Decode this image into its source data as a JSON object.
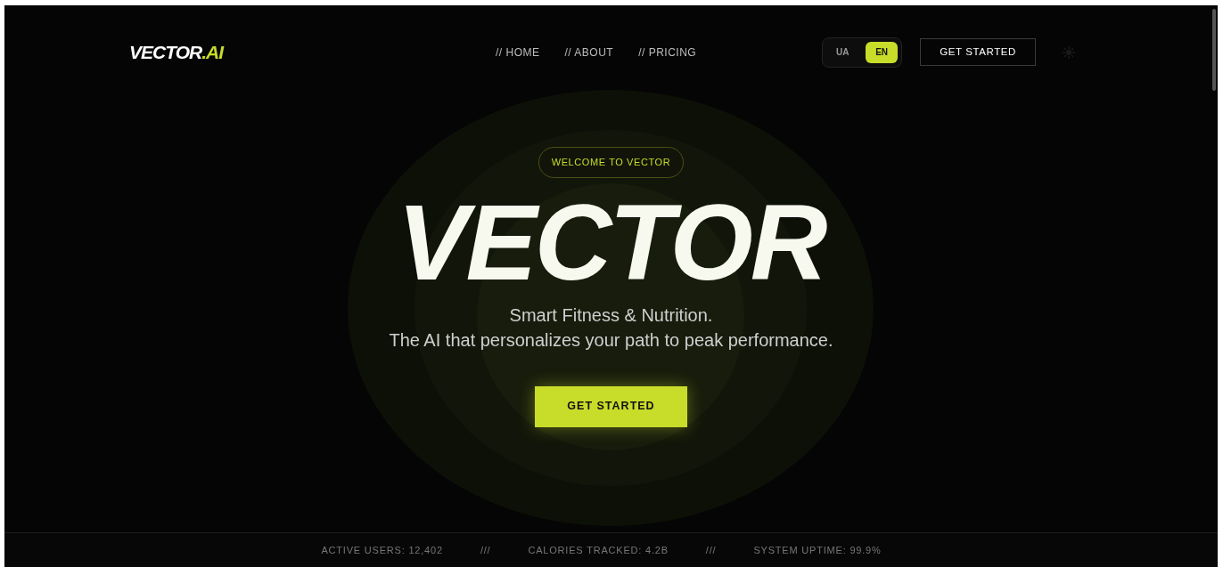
{
  "logo": {
    "main": "VECTOR",
    "accent": ".AI"
  },
  "nav": [
    "// HOME",
    "// ABOUT",
    "// PRICING"
  ],
  "languages": [
    {
      "label": "UA",
      "selected": false
    },
    {
      "label": "EN",
      "selected": true
    }
  ],
  "header_button": "GET STARTED",
  "hero": {
    "badge": "WELCOME TO VECTOR",
    "title": "VECTOR",
    "subtitle": "Smart Fitness & Nutrition.",
    "tagline": "The AI that personalizes your path to peak performance.",
    "button": "GET STARTED"
  },
  "stats": [
    "ACTIVE USERS: 12,402",
    "///",
    "CALORIES TRACKED: 4.2B",
    "///",
    "SYSTEM UPTIME: 99.9%"
  ]
}
